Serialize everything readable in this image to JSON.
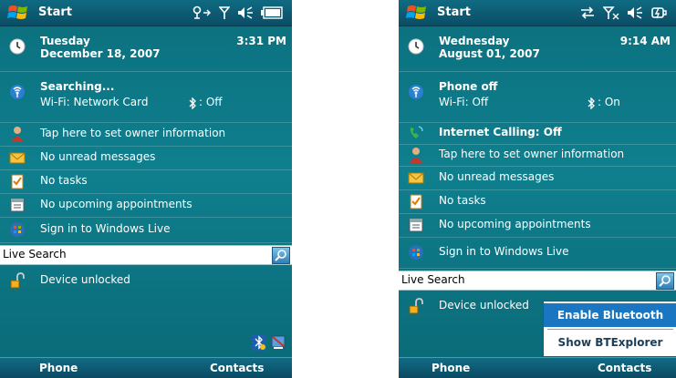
{
  "left": {
    "title": "Start",
    "date_line1": "Tuesday",
    "date_line2": "December 18, 2007",
    "time": "3:31 PM",
    "wifi_title": "Searching...",
    "wifi_sub": "Wi-Fi: Network Card",
    "bt_status": ": Off",
    "owner": "Tap here to set owner information",
    "messages": "No unread messages",
    "tasks": "No tasks",
    "appointments": "No upcoming appointments",
    "live": "Sign in to Windows Live",
    "search": "Live Search",
    "lock": "Device unlocked",
    "softkey_left": "Phone",
    "softkey_right": "Contacts"
  },
  "right": {
    "title": "Start",
    "date_line1": "Wednesday",
    "date_line2": "August 01, 2007",
    "time": "9:14 AM",
    "wifi_title": "Phone off",
    "wifi_sub": "Wi-Fi: Off",
    "bt_status": ": On",
    "calling": "Internet Calling: Off",
    "owner": "Tap here to set owner information",
    "messages": "No unread messages",
    "tasks": "No tasks",
    "appointments": "No upcoming appointments",
    "live": "Sign in to Windows Live",
    "search": "Live Search",
    "lock": "Device unlocked",
    "popup_item1": "Enable Bluetooth",
    "popup_item2": "Show BTExplorer",
    "softkey_left": "Phone",
    "softkey_right": "Contacts"
  }
}
